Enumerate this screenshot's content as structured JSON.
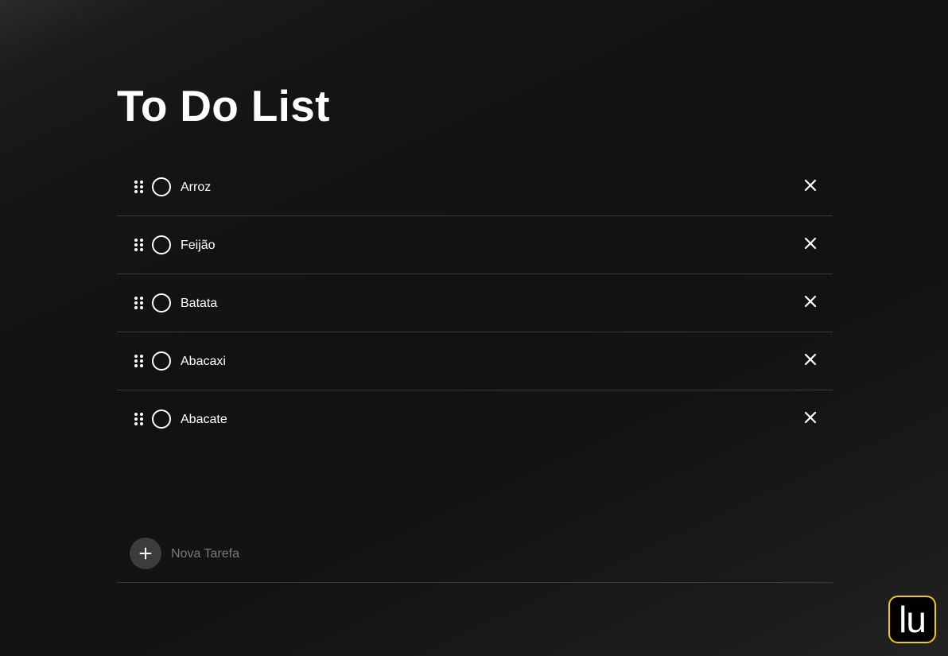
{
  "page": {
    "title": "To Do List"
  },
  "tasks": [
    {
      "label": "Arroz",
      "completed": false
    },
    {
      "label": "Feijão",
      "completed": false
    },
    {
      "label": "Batata",
      "completed": false
    },
    {
      "label": "Abacaxi",
      "completed": false
    },
    {
      "label": "Abacate",
      "completed": false
    }
  ],
  "new_task": {
    "placeholder": "Nova Tarefa",
    "value": ""
  },
  "icons": {
    "drag": "drag-handle-icon",
    "checkbox": "circle-checkbox-icon",
    "remove": "close-icon",
    "add": "plus-icon"
  },
  "logo": {
    "text": "lu"
  },
  "colors": {
    "background": "#121212",
    "text": "#ffffff",
    "divider": "#3b3b3b",
    "add_button": "#3c3c3c",
    "placeholder": "#7a7a7a",
    "logo_border": "#f5c518"
  }
}
